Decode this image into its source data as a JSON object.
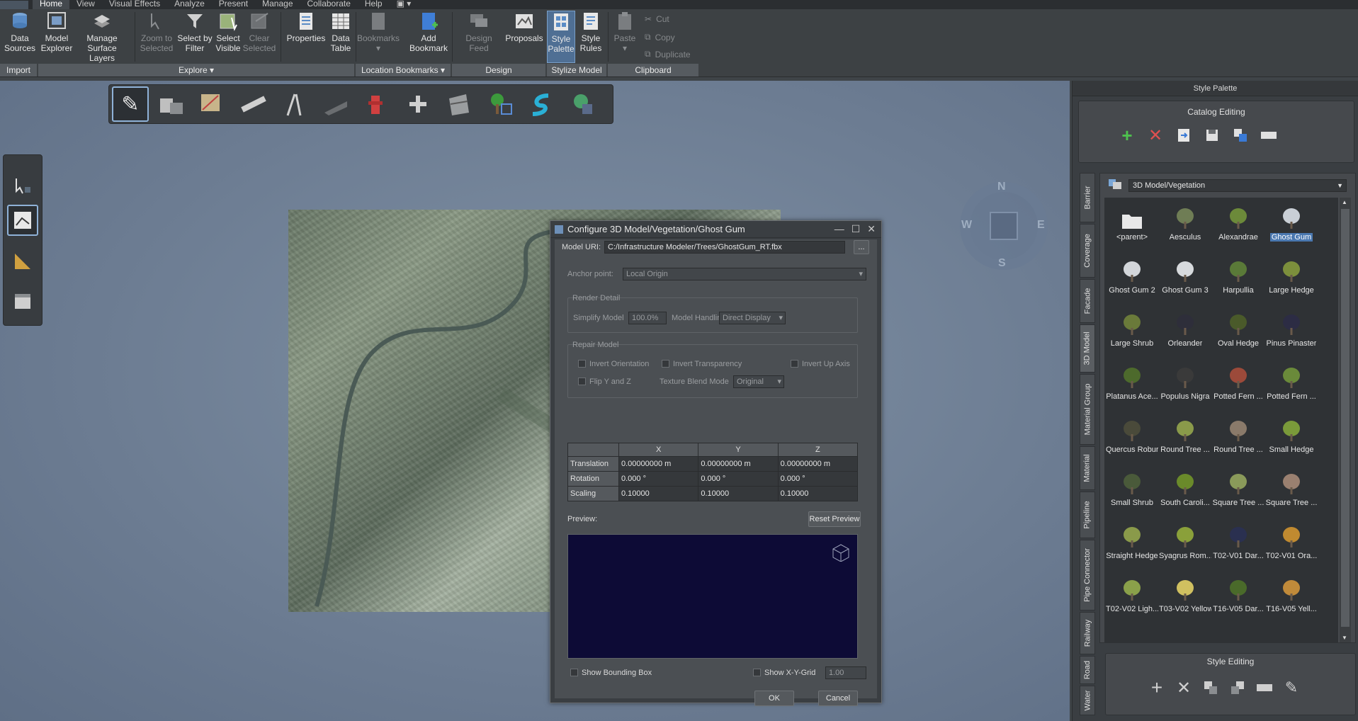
{
  "menubar": {
    "items": [
      "Home",
      "View",
      "Visual Effects",
      "Analyze",
      "Present",
      "Manage",
      "Collaborate",
      "Help"
    ]
  },
  "ribbon": {
    "buttons": [
      {
        "key": "data_sources",
        "label": "Data\nSources"
      },
      {
        "key": "model_explorer",
        "label": "Model\nExplorer"
      },
      {
        "key": "manage_surface_layers",
        "label": "Manage\nSurface Layers"
      },
      {
        "key": "zoom_to_selected",
        "label": "Zoom to\nSelected"
      },
      {
        "key": "select_by_filter",
        "label": "Select by\nFilter"
      },
      {
        "key": "select_visible",
        "label": "Select\nVisible"
      },
      {
        "key": "clear_selected",
        "label": "Clear\nSelected"
      },
      {
        "key": "properties",
        "label": "Properties"
      },
      {
        "key": "data_table",
        "label": "Data\nTable"
      },
      {
        "key": "bookmarks",
        "label": "Bookmarks"
      },
      {
        "key": "add_bookmark",
        "label": "Add\nBookmark"
      },
      {
        "key": "design_feed",
        "label": "Design Feed"
      },
      {
        "key": "proposals",
        "label": "Proposals"
      },
      {
        "key": "style_palette",
        "label": "Style\nPalette"
      },
      {
        "key": "style_rules",
        "label": "Style\nRules"
      },
      {
        "key": "paste",
        "label": "Paste"
      }
    ],
    "clipboard_small": [
      "Cut",
      "Copy",
      "Duplicate"
    ],
    "groups": [
      "Import",
      "Explore",
      "Location Bookmarks",
      "Design",
      "Stylize Model",
      "Clipboard"
    ]
  },
  "compass": {
    "n": "N",
    "s": "S",
    "e": "E",
    "w": "W"
  },
  "dialog": {
    "title": "Configure 3D Model/Vegetation/Ghost Gum",
    "model_uri_label": "Model URI:",
    "model_uri": "C:/Infrastructure Modeler/Trees/GhostGum_RT.fbx",
    "browse": "...",
    "anchor_label": "Anchor point:",
    "anchor_value": "Local Origin",
    "render_detail": "Render Detail",
    "simplify_label": "Simplify Model",
    "simplify_value": "100.0%",
    "model_handling_label": "Model Handling",
    "model_handling_value": "Direct Display",
    "repair_model": "Repair Model",
    "invert_orientation": "Invert Orientation",
    "invert_transparency": "Invert Transparency",
    "invert_up_axis": "Invert Up Axis",
    "flip_yz": "Flip Y and Z",
    "texture_blend_label": "Texture Blend Mode",
    "texture_blend_value": "Original",
    "table": {
      "headers": [
        "",
        "X",
        "Y",
        "Z"
      ],
      "rows": [
        [
          "Translation",
          "0.00000000 m",
          "0.00000000 m",
          "0.00000000 m"
        ],
        [
          "Rotation",
          "0.000 °",
          "0.000 °",
          "0.000 °"
        ],
        [
          "Scaling",
          "0.10000",
          "0.10000",
          "0.10000"
        ]
      ]
    },
    "preview_label": "Preview:",
    "reset_preview": "Reset Preview",
    "show_bbox": "Show Bounding Box",
    "show_grid": "Show X-Y-Grid",
    "grid_value": "1.00",
    "ok": "OK",
    "cancel": "Cancel"
  },
  "palette": {
    "title": "Style Palette",
    "catalog_editing": "Catalog Editing",
    "style_editing": "Style Editing",
    "combo": "3D Model/Vegetation",
    "tabs": [
      "Barrier",
      "Coverage",
      "Facade",
      "3D Model",
      "Material Group",
      "Material",
      "Pipeline",
      "Pipe Connector",
      "Railway",
      "Road",
      "Water"
    ],
    "items": [
      {
        "name": "<parent>",
        "kind": "folder"
      },
      {
        "name": "Aesculus",
        "color": "#6f7d55"
      },
      {
        "name": "Alexandrae",
        "color": "#6c8a3a"
      },
      {
        "name": "Ghost Gum",
        "color": "#c9cfd6"
      },
      {
        "name": "Ghost Gum 2",
        "color": "#d3d6da"
      },
      {
        "name": "Ghost Gum 3",
        "color": "#d7dadd"
      },
      {
        "name": "Harpullia",
        "color": "#5a7a38"
      },
      {
        "name": "Large Hedge",
        "color": "#7c8f3c"
      },
      {
        "name": "Large Shrub",
        "color": "#6a7a3a"
      },
      {
        "name": "Orleander",
        "color": "#2e2e3a"
      },
      {
        "name": "Oval Hedge",
        "color": "#4a5a2a"
      },
      {
        "name": "Pinus Pinaster",
        "color": "#2c2c44"
      },
      {
        "name": "Platanus Ace...",
        "color": "#4d6a2c"
      },
      {
        "name": "Populus Nigra",
        "color": "#3a3a3a"
      },
      {
        "name": "Potted Fern ...",
        "color": "#9c4a3a"
      },
      {
        "name": "Potted Fern ...",
        "color": "#6a8a3a"
      },
      {
        "name": "Quercus Robur",
        "color": "#4a4a3a"
      },
      {
        "name": "Round Tree ...",
        "color": "#8a9a4a"
      },
      {
        "name": "Round Tree ...",
        "color": "#8a7a6a"
      },
      {
        "name": "Small Hedge",
        "color": "#7a9a3a"
      },
      {
        "name": "Small Shrub",
        "color": "#4a5a3a"
      },
      {
        "name": "South Caroli...",
        "color": "#6a8a2a"
      },
      {
        "name": "Square Tree ...",
        "color": "#8a9a5a"
      },
      {
        "name": "Square Tree ...",
        "color": "#9a8070"
      },
      {
        "name": "Straight Hedge",
        "color": "#8a9a4a"
      },
      {
        "name": "Syagrus Rom...",
        "color": "#8aa03a"
      },
      {
        "name": "T02-V01 Dar...",
        "color": "#2a3050"
      },
      {
        "name": "T02-V01 Ora...",
        "color": "#c08a30"
      },
      {
        "name": "T02-V02 Ligh...",
        "color": "#8aa04a"
      },
      {
        "name": "T03-V02 Yellow",
        "color": "#d0c060"
      },
      {
        "name": "T16-V05 Dar...",
        "color": "#4a6a2a"
      },
      {
        "name": "T16-V05 Yell...",
        "color": "#c08a3a"
      }
    ]
  }
}
